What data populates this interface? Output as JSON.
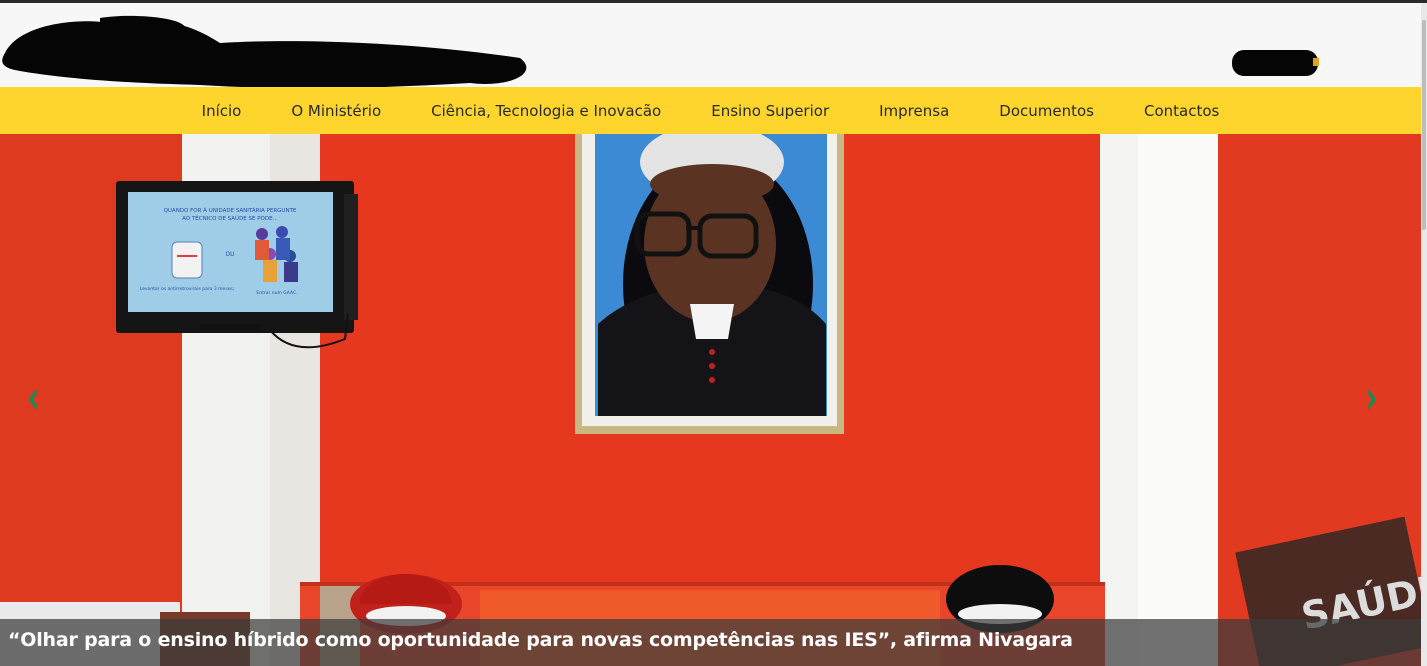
{
  "nav": {
    "items": [
      {
        "label": "Início"
      },
      {
        "label": "O Ministério"
      },
      {
        "label": "Ciência, Tecnologia e Inovacão"
      },
      {
        "label": "Ensino Superior"
      },
      {
        "label": "Imprensa"
      },
      {
        "label": "Documentos"
      },
      {
        "label": "Contactos"
      }
    ]
  },
  "slider": {
    "prev_label": "‹",
    "next_label": "›",
    "caption": "“Olhar para o ensino híbrido como oportunidade para novas competências nas IES”, afirma Nivagara",
    "tv_text": {
      "line1": "QUANDO FOR À UNIDADE SANITÁRIA PERGUNTE",
      "line2": "AO TÉCNICO DE SAÚDE SE PODE...",
      "ou": "OU",
      "left_caption": "Levantar os antirretrovirais para 3 meses;",
      "right_caption": "Entrar num GAAC."
    },
    "sign_text": "SAÚDE",
    "colors": {
      "nav_bg": "#fdd52d",
      "hero_wall": "#e5381e",
      "arrow": "#0f8e55"
    }
  }
}
